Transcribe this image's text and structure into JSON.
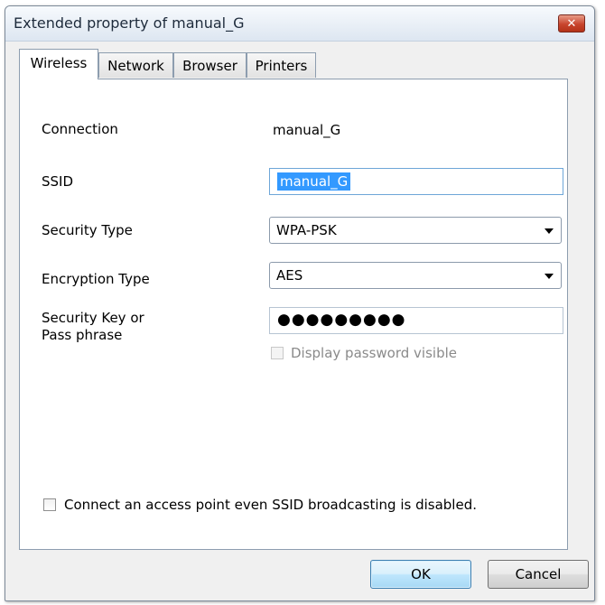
{
  "window": {
    "title": "Extended property of manual_G",
    "close_glyph": "✕"
  },
  "tabs": [
    {
      "label": "Wireless",
      "active": true
    },
    {
      "label": "Network",
      "active": false
    },
    {
      "label": "Browser",
      "active": false
    },
    {
      "label": "Printers",
      "active": false
    }
  ],
  "form": {
    "connection_label": "Connection",
    "connection_value": "manual_G",
    "ssid_label": "SSID",
    "ssid_value": "manual_G",
    "security_type_label": "Security Type",
    "security_type_value": "WPA-PSK",
    "encryption_type_label": "Encryption Type",
    "encryption_type_value": "AES",
    "security_key_label_line1": "Security Key or",
    "security_key_label_line2": "Pass phrase",
    "security_key_masked": "●●●●●●●●●",
    "display_password_label": "Display password visible",
    "display_password_checked": false,
    "display_password_enabled": false,
    "hidden_ssid_label": "Connect an access point even SSID broadcasting is disabled.",
    "hidden_ssid_checked": false
  },
  "buttons": {
    "ok_label": "OK",
    "cancel_label": "Cancel"
  },
  "icons": {
    "close": "close-icon",
    "dropdown": "chevron-down-icon"
  },
  "colors": {
    "selection": "#3399ff",
    "close_button": "#c8452e",
    "default_button_border": "#3c7fb1"
  }
}
